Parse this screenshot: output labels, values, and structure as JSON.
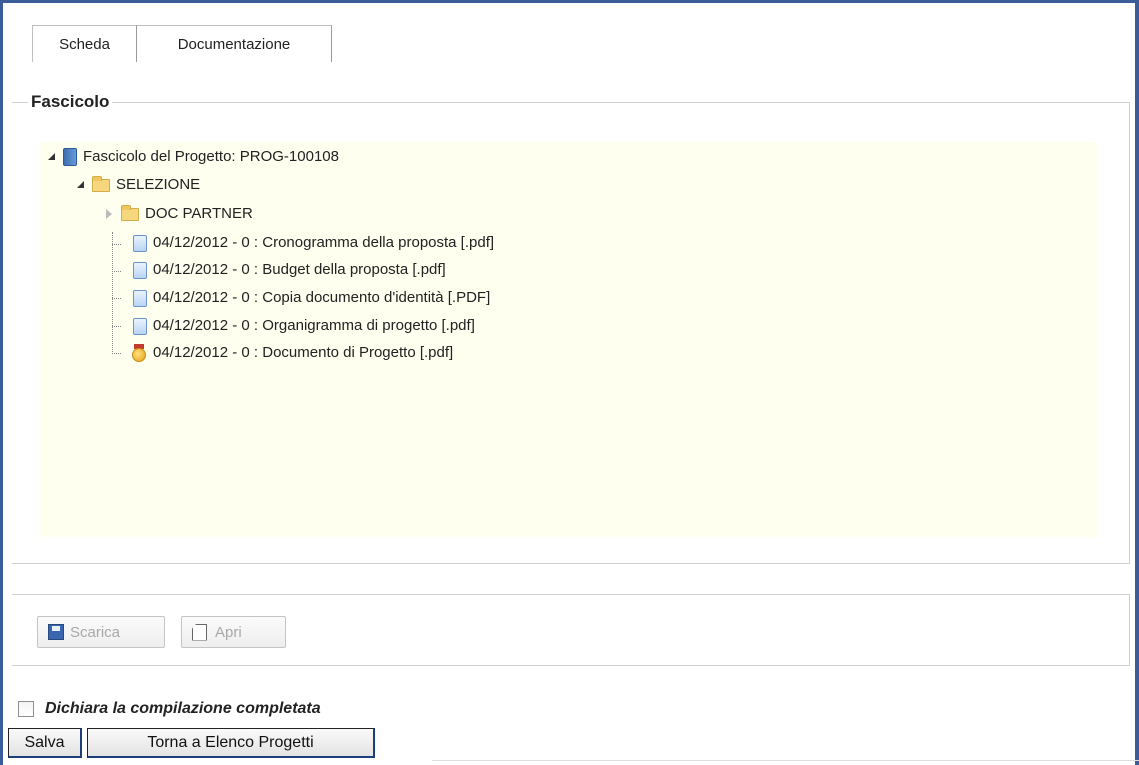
{
  "tabs": [
    {
      "label": "Scheda"
    },
    {
      "label": "Documentazione"
    }
  ],
  "fieldset": {
    "legend": "Fascicolo"
  },
  "tree": {
    "root": {
      "label": "Fascicolo del Progetto: PROG-100108",
      "icon": "book-icon"
    },
    "folder": {
      "label": "SELEZIONE",
      "icon": "folder-icon"
    },
    "subfolder": {
      "label": "DOC PARTNER",
      "icon": "folder-icon"
    },
    "documents": [
      {
        "label": "04/12/2012 - 0 : Cronogramma della proposta  [.pdf]",
        "icon": "document-icon"
      },
      {
        "label": "04/12/2012 - 0 : Budget della proposta  [.pdf]",
        "icon": "document-icon"
      },
      {
        "label": "04/12/2012 - 0 : Copia documento d'identità  [.PDF]",
        "icon": "document-icon"
      },
      {
        "label": "04/12/2012 - 0 : Organigramma di progetto  [.pdf]",
        "icon": "document-icon"
      },
      {
        "label": "04/12/2012 - 0 : Documento di Progetto  [.pdf]",
        "icon": "medal-icon"
      }
    ]
  },
  "toolbar": {
    "download_label": "Scarica",
    "open_label": "Apri"
  },
  "declaration": {
    "label": "Dichiara la compilazione completata"
  },
  "actions": {
    "save_label": "Salva",
    "back_label": "Torna a Elenco Progetti"
  }
}
